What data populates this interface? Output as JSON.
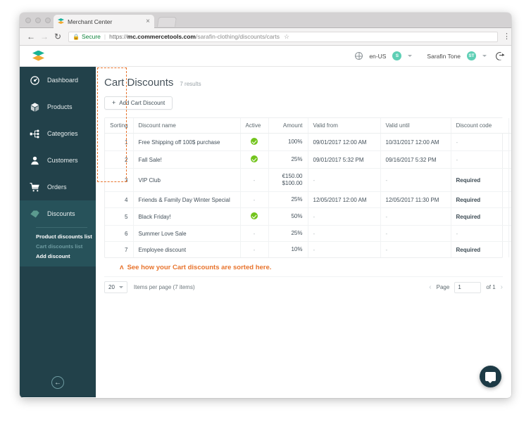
{
  "browser": {
    "tab_title": "Merchant Center",
    "tab_close": "×",
    "back_icon": "←",
    "forward_icon": "→",
    "reload_icon": "↻",
    "lock_icon": "🔒",
    "secure_label": "Secure",
    "separator": "|",
    "url_scheme": "https://",
    "url_host": "mc.commercetools.com",
    "url_path": "/sarafin-clothing/discounts/carts",
    "star_icon": "☆",
    "menu_icon": "⋮"
  },
  "topbar": {
    "locale": "en-US",
    "project_initial": "S",
    "user_name": "Sarafin Tone",
    "user_initial": "ST",
    "globe_icon": "globe-icon",
    "logout_icon": "logout-icon"
  },
  "sidebar": {
    "items": [
      {
        "label": "Dashboard",
        "icon": "dashboard-icon",
        "active": false
      },
      {
        "label": "Products",
        "icon": "box-icon",
        "active": false
      },
      {
        "label": "Categories",
        "icon": "categories-icon",
        "active": false
      },
      {
        "label": "Customers",
        "icon": "user-icon",
        "active": false
      },
      {
        "label": "Orders",
        "icon": "cart-icon",
        "active": false
      },
      {
        "label": "Discounts",
        "icon": "discounts-icon",
        "active": true
      }
    ],
    "subitems": [
      {
        "label": "Product discounts list",
        "selected": false
      },
      {
        "label": "Cart discounts list",
        "selected": true
      },
      {
        "label": "Add discount",
        "selected": false
      }
    ],
    "collapse_icon": "←"
  },
  "main": {
    "title": "Cart Discounts",
    "result_count": "7 results",
    "add_button": "Add Cart Discount",
    "add_button_plus": "+",
    "annotation": "See how your Cart discounts are sorted here.",
    "annotation_caret": "ʌ",
    "columns": [
      "Sorting",
      "Discount name",
      "Active",
      "Amount",
      "Valid from",
      "Valid until",
      "Discount code",
      ""
    ],
    "rows": [
      {
        "sorting": "1",
        "name": "Free Shipping off 100$ purchase",
        "active": true,
        "amount": "100%",
        "amount2": "",
        "valid_from": "09/01/2017 12:00 AM",
        "valid_until": "10/31/2017 12:00 AM",
        "code": "-",
        "code_required": false
      },
      {
        "sorting": "2",
        "name": "Fall Sale!",
        "active": true,
        "amount": "25%",
        "amount2": "",
        "valid_from": "09/01/2017 5:32 PM",
        "valid_until": "09/16/2017 5:32 PM",
        "code": "-",
        "code_required": false
      },
      {
        "sorting": "3",
        "name": "VIP Club",
        "active": false,
        "amount": "€150.00",
        "amount2": "$100.00",
        "valid_from": "-",
        "valid_until": "-",
        "code": "Required",
        "code_required": true
      },
      {
        "sorting": "4",
        "name": "Friends & Family Day Winter Special",
        "active": false,
        "amount": "25%",
        "amount2": "",
        "valid_from": "12/05/2017 12:00 AM",
        "valid_until": "12/05/2017 11:30 PM",
        "code": "Required",
        "code_required": true
      },
      {
        "sorting": "5",
        "name": "Black Friday!",
        "active": true,
        "amount": "50%",
        "amount2": "",
        "valid_from": "-",
        "valid_until": "-",
        "code": "Required",
        "code_required": true
      },
      {
        "sorting": "6",
        "name": "Summer Love Sale",
        "active": false,
        "amount": "25%",
        "amount2": "",
        "valid_from": "-",
        "valid_until": "-",
        "code": "-",
        "code_required": false
      },
      {
        "sorting": "7",
        "name": "Employee discount",
        "active": false,
        "amount": "10%",
        "amount2": "",
        "valid_from": "-",
        "valid_until": "-",
        "code": "Required",
        "code_required": true
      }
    ],
    "pager": {
      "per_page_value": "20",
      "per_page_label": "Items per page (7 items)",
      "prev_icon": "‹",
      "next_icon": "›",
      "page_word": "Page",
      "page_value": "1",
      "of_label": "of 1"
    }
  },
  "chat": {
    "icon": "chat-bubble-icon"
  },
  "colors": {
    "sidebar_bg": "#22414a",
    "sidebar_active": "#27525a",
    "accent_teal": "#1ab394",
    "accent_orange": "#e8732c",
    "check_green": "#73c41d"
  }
}
